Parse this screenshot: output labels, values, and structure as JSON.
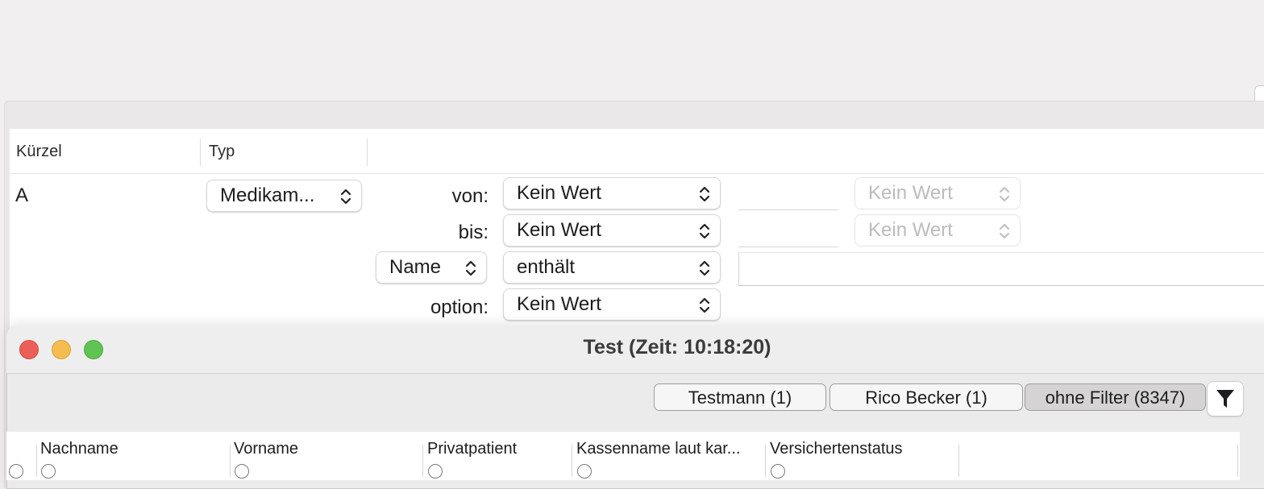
{
  "editor": {
    "columns": [
      "Kürzel",
      "Typ"
    ],
    "row": {
      "kuerzel": "A",
      "typ": "Medikam...",
      "von_label": "von:",
      "von_value": "Kein Wert",
      "von_secondary": "Kein Wert",
      "bis_label": "bis:",
      "bis_value": "Kein Wert",
      "bis_secondary": "Kein Wert",
      "field_select": "Name",
      "condition": "enthält",
      "option_label": "option:",
      "option_value": "Kein Wert"
    }
  },
  "window": {
    "title": "Test  (Zeit: 10:18:20)",
    "filters": [
      "Testmann (1)",
      "Rico Becker (1)",
      "ohne Filter (8347)"
    ],
    "active_filter": "ohne Filter (8347)",
    "table_headers": [
      "Nachname",
      "Vorname",
      "Privatpatient",
      "Kassenname laut kar...",
      "Versichertenstatus"
    ]
  },
  "colors": {
    "close": "#ec5f58",
    "minimize": "#f5bd4f",
    "zoom": "#5fc453"
  }
}
